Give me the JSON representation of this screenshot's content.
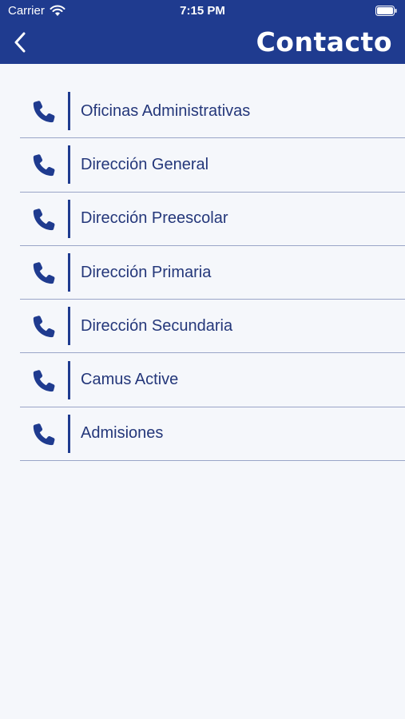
{
  "status_bar": {
    "carrier": "Carrier",
    "time": "7:15 PM"
  },
  "header": {
    "title": "Contacto",
    "back_icon": "chevron-left-icon"
  },
  "colors": {
    "header_bg": "#1f3b8f",
    "accent": "#1f3b8f",
    "text": "#24377a",
    "background": "#f5f7fb"
  },
  "contacts": [
    {
      "label": "Oficinas Administrativas",
      "icon": "phone-icon"
    },
    {
      "label": "Dirección General",
      "icon": "phone-icon"
    },
    {
      "label": "Dirección Preescolar",
      "icon": "phone-icon"
    },
    {
      "label": "Dirección Primaria",
      "icon": "phone-icon"
    },
    {
      "label": "Dirección Secundaria",
      "icon": "phone-icon"
    },
    {
      "label": "Camus Active",
      "icon": "phone-icon"
    },
    {
      "label": "Admisiones",
      "icon": "phone-icon"
    }
  ]
}
